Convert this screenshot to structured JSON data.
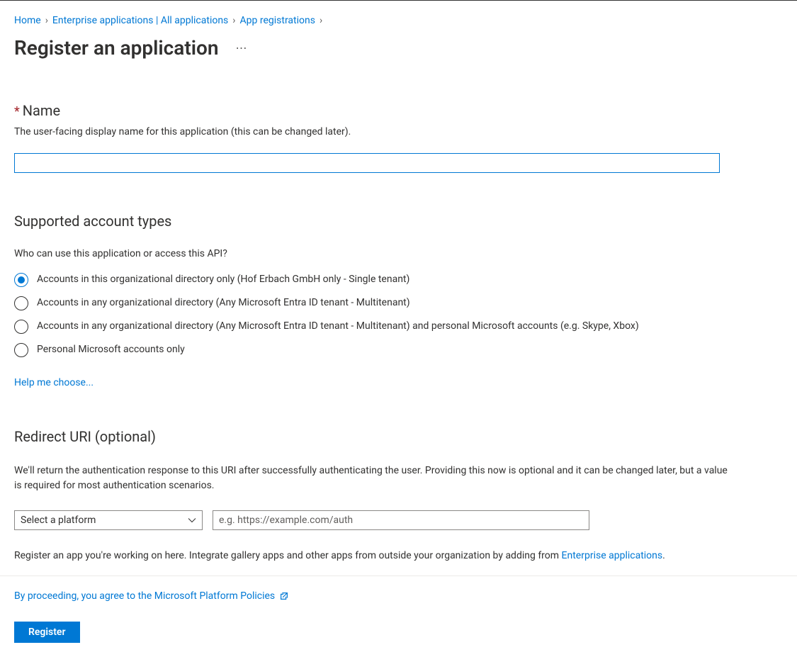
{
  "breadcrumb": {
    "items": [
      {
        "label": "Home"
      },
      {
        "label": "Enterprise applications | All applications"
      },
      {
        "label": "App registrations"
      }
    ]
  },
  "page": {
    "title": "Register an application"
  },
  "name_field": {
    "required_mark": "*",
    "label": "Name",
    "helper": "The user-facing display name for this application (this can be changed later).",
    "value": ""
  },
  "account_types": {
    "heading": "Supported account types",
    "question": "Who can use this application or access this API?",
    "options": [
      {
        "label": "Accounts in this organizational directory only (Hof Erbach GmbH only - Single tenant)",
        "selected": true
      },
      {
        "label": "Accounts in any organizational directory (Any Microsoft Entra ID tenant - Multitenant)",
        "selected": false
      },
      {
        "label": "Accounts in any organizational directory (Any Microsoft Entra ID tenant - Multitenant) and personal Microsoft accounts (e.g. Skype, Xbox)",
        "selected": false
      },
      {
        "label": "Personal Microsoft accounts only",
        "selected": false
      }
    ],
    "help_link": "Help me choose..."
  },
  "redirect": {
    "heading": "Redirect URI (optional)",
    "description": "We'll return the authentication response to this URI after successfully authenticating the user. Providing this now is optional and it can be changed later, but a value is required for most authentication scenarios.",
    "platform_placeholder": "Select a platform",
    "uri_placeholder": "e.g. https://example.com/auth"
  },
  "integrate": {
    "text_prefix": "Register an app you're working on here. Integrate gallery apps and other apps from outside your organization by adding from ",
    "link_text": "Enterprise applications",
    "text_suffix": "."
  },
  "footer": {
    "policies_link": "By proceeding, you agree to the Microsoft Platform Policies",
    "register_label": "Register"
  }
}
